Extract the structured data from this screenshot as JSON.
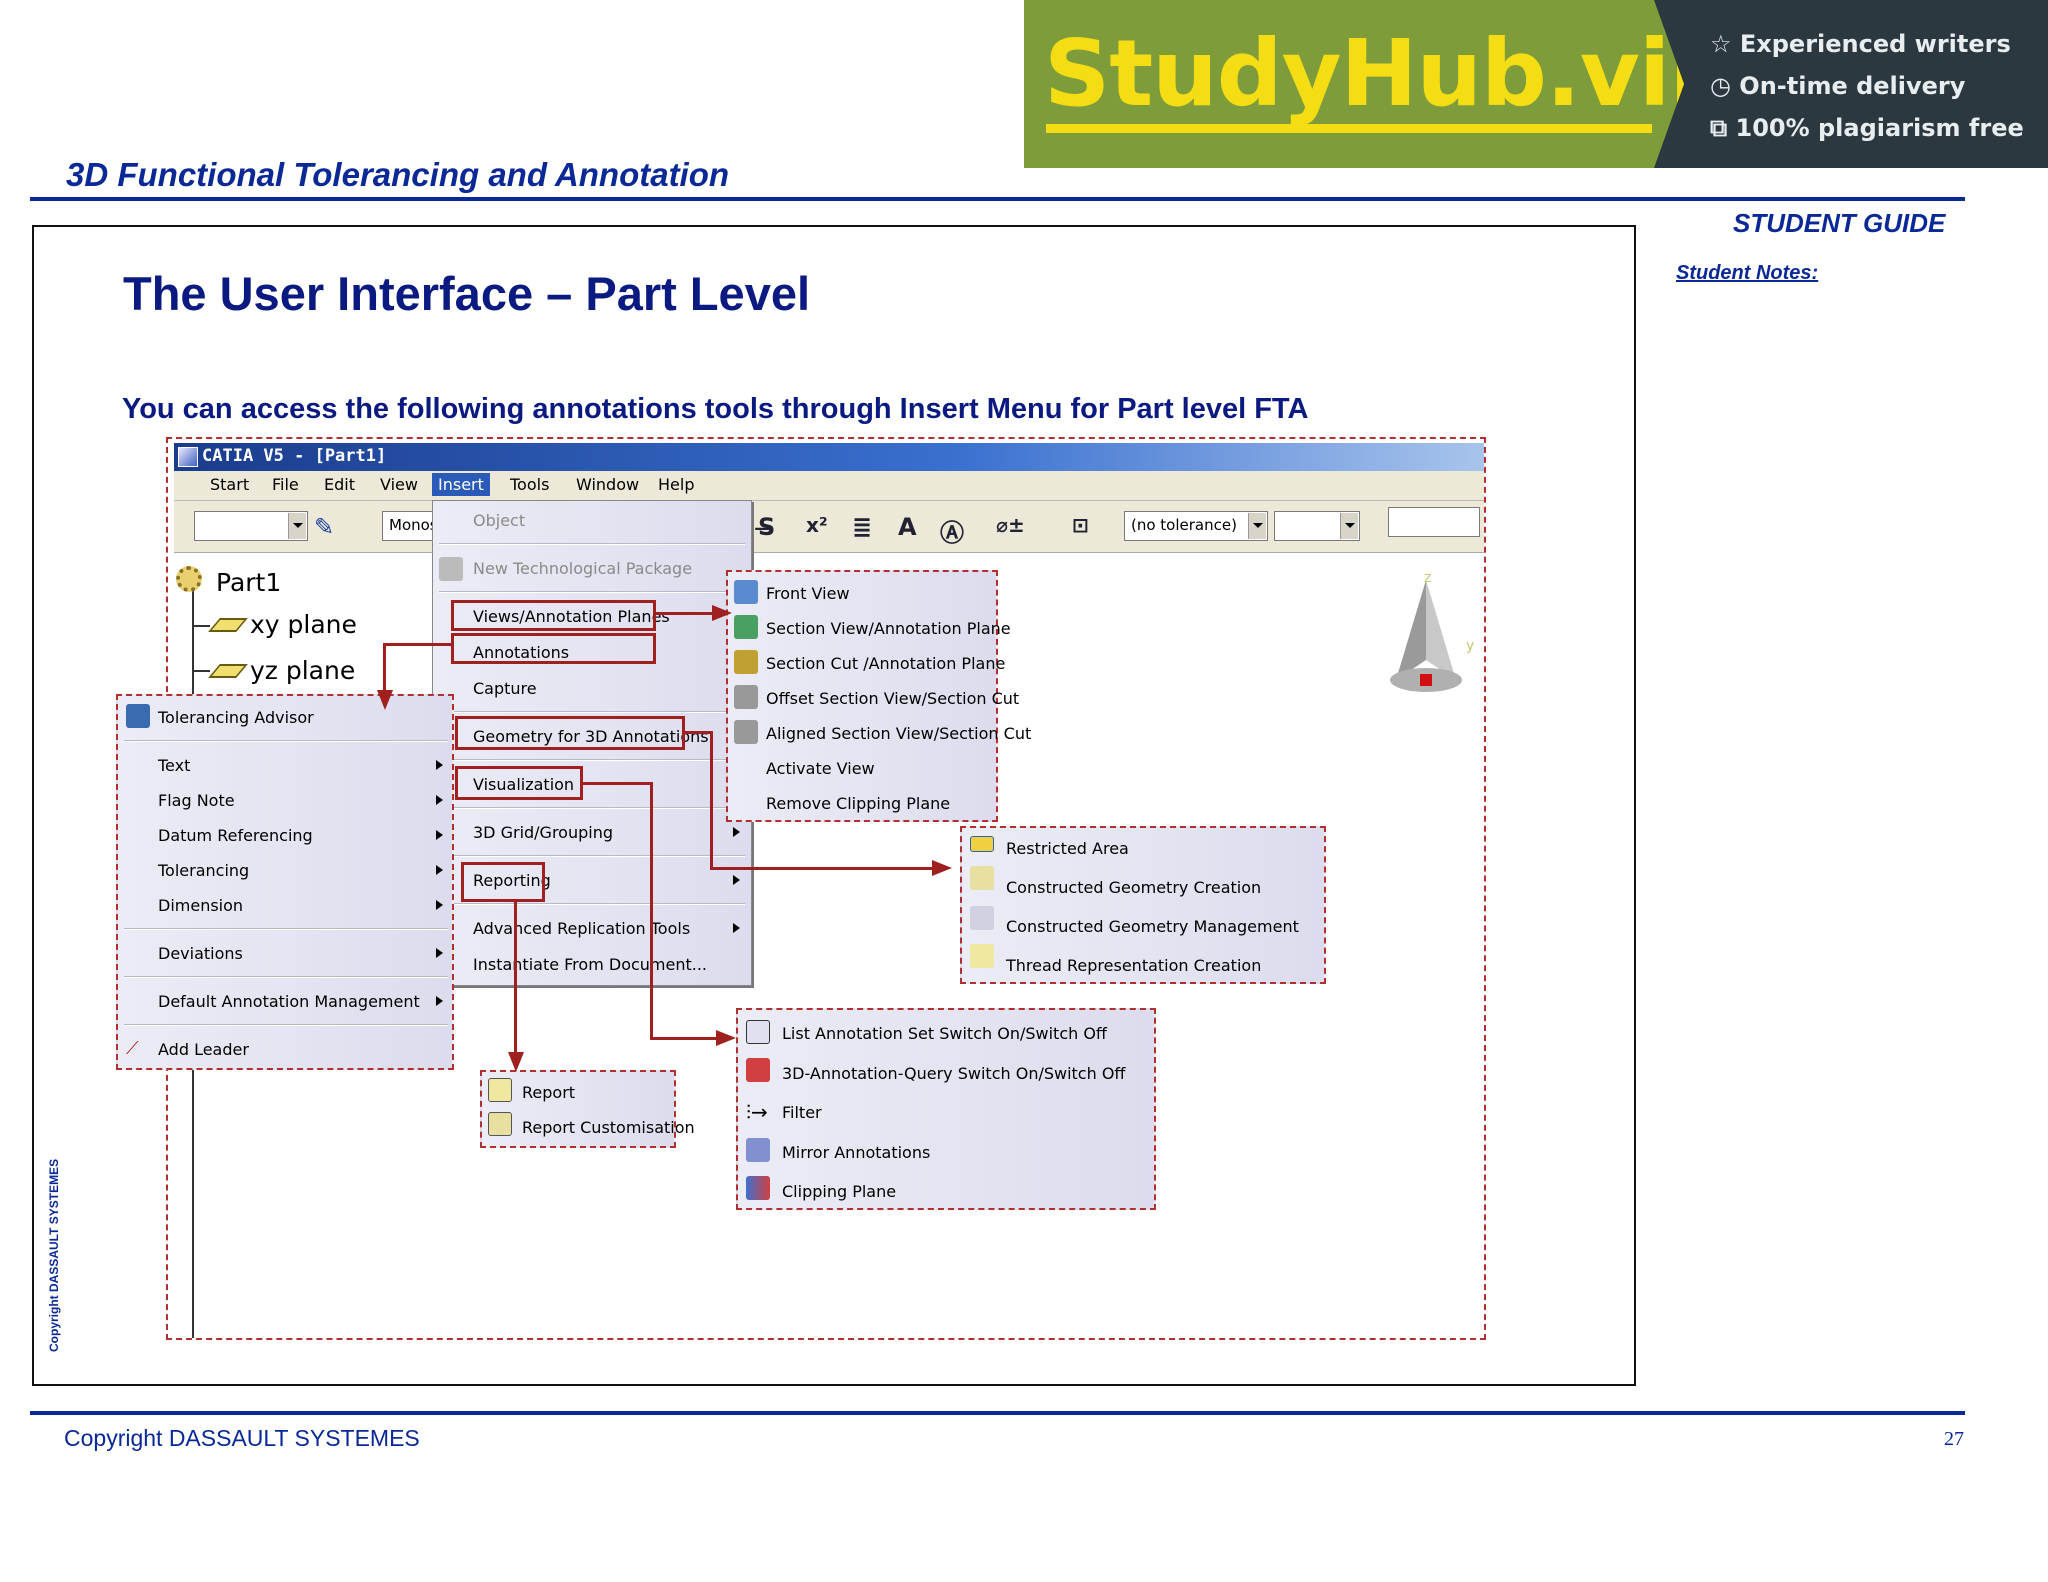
{
  "banner": {
    "brand": "StudyHub.vip",
    "features": [
      "Experienced writers",
      "On-time delivery",
      "100% plagiarism free"
    ],
    "feature_icons": [
      "star-icon",
      "clock-icon",
      "copy-icon"
    ],
    "colors": {
      "green": "#7e9d3a",
      "dark": "#2c3840",
      "yellow": "#f5dd14"
    }
  },
  "header": {
    "doc_title": "3D Functional Tolerancing and Annotation",
    "guide_label": "STUDENT GUIDE",
    "notes_label": "Student Notes:"
  },
  "slide": {
    "title": "The User Interface – Part Level",
    "subtitle": "You can access the following annotations tools through Insert Menu for Part level FTA"
  },
  "catia": {
    "window_title": "CATIA V5 - [Part1]",
    "menubar": [
      "Start",
      "File",
      "Edit",
      "View",
      "Insert",
      "Tools",
      "Window",
      "Help"
    ],
    "toolbar": {
      "font_combo": "Monos",
      "tolerance_combo": "(no tolerance)"
    },
    "tree": [
      "Part1",
      "xy plane",
      "yz plane"
    ],
    "insert_menu": [
      "Object",
      "New Technological Package",
      "Views/Annotation Planes",
      "Annotations",
      "Capture",
      "Geometry for 3D Annotations",
      "Visualization",
      "3D Grid/Grouping",
      "Reporting",
      "Advanced Replication Tools",
      "Instantiate From Document..."
    ],
    "views_menu": [
      "Front View",
      "Section View/Annotation Plane",
      "Section Cut /Annotation Plane",
      "Offset Section View/Section Cut",
      "Aligned Section View/Section Cut",
      "Activate View",
      "Remove Clipping Plane"
    ],
    "annotations_menu": [
      "Tolerancing Advisor",
      "Text",
      "Flag Note",
      "Datum Referencing",
      "Tolerancing",
      "Dimension",
      "Deviations",
      "Default Annotation Management",
      "Add Leader"
    ],
    "geometry_menu": [
      "Restricted Area",
      "Constructed Geometry Creation",
      "Constructed Geometry Management",
      "Thread Representation Creation"
    ],
    "visualization_menu": [
      "List Annotation Set Switch On/Switch Off",
      "3D-Annotation-Query Switch On/Switch Off",
      "Filter",
      "Mirror Annotations",
      "Clipping Plane"
    ],
    "reporting_menu": [
      "Report",
      "Report Customisation"
    ]
  },
  "footer": {
    "side_copyright": "Copyright DASSAULT SYSTEMES",
    "copyright": "Copyright DASSAULT SYSTEMES",
    "page_number": "27"
  }
}
